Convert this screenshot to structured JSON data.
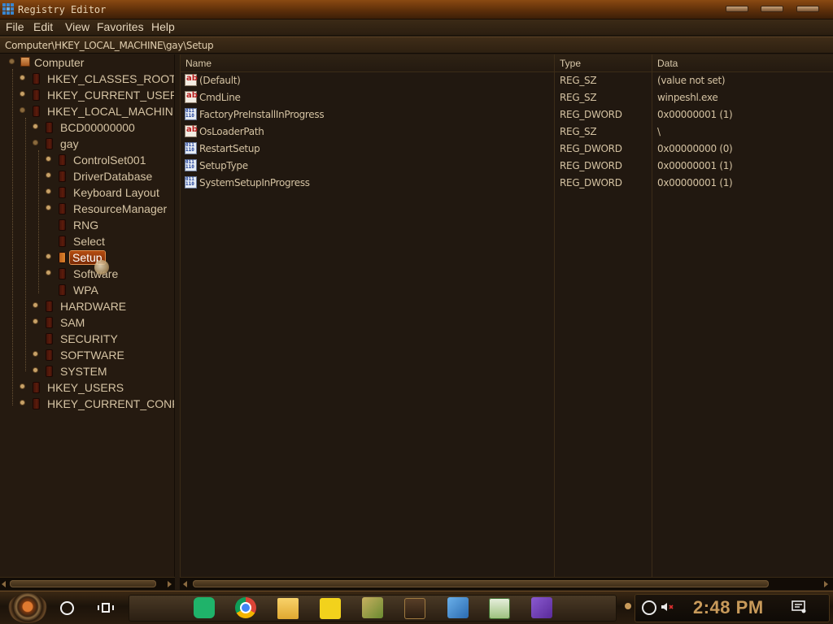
{
  "window": {
    "title": "Registry Editor"
  },
  "menu": {
    "file": "File",
    "edit": "Edit",
    "view": "View",
    "favorites": "Favorites",
    "help": "Help"
  },
  "address": {
    "path": "Computer\\HKEY_LOCAL_MACHINE\\gay\\Setup"
  },
  "tree": {
    "computer": "Computer",
    "hkcr": "HKEY_CLASSES_ROOT",
    "hkcu": "HKEY_CURRENT_USER",
    "hklm": "HKEY_LOCAL_MACHINE",
    "bcd": "BCD00000000",
    "gay": "gay",
    "controlset": "ControlSet001",
    "driverdb": "DriverDatabase",
    "keyboard": "Keyboard Layout",
    "resmgr": "ResourceManager",
    "rng": "RNG",
    "select": "Select",
    "setup": "Setup",
    "software_sub": "Software",
    "wpa": "WPA",
    "hardware": "HARDWARE",
    "sam": "SAM",
    "security": "SECURITY",
    "software": "SOFTWARE",
    "system": "SYSTEM",
    "hku": "HKEY_USERS",
    "hkcc": "HKEY_CURRENT_CONFIG"
  },
  "columns": {
    "name": "Name",
    "type": "Type",
    "data": "Data"
  },
  "values": [
    {
      "name": "(Default)",
      "type": "REG_SZ",
      "data": "(value not set)",
      "icon": "string-value-icon"
    },
    {
      "name": "CmdLine",
      "type": "REG_SZ",
      "data": "winpeshl.exe",
      "icon": "string-value-icon"
    },
    {
      "name": "FactoryPreInstallInProgress",
      "type": "REG_DWORD",
      "data": "0x00000001 (1)",
      "icon": "binary-value-icon"
    },
    {
      "name": "OsLoaderPath",
      "type": "REG_SZ",
      "data": "\\",
      "icon": "string-value-icon"
    },
    {
      "name": "RestartSetup",
      "type": "REG_DWORD",
      "data": "0x00000000 (0)",
      "icon": "binary-value-icon"
    },
    {
      "name": "SetupType",
      "type": "REG_DWORD",
      "data": "0x00000001 (1)",
      "icon": "binary-value-icon"
    },
    {
      "name": "SystemSetupInProgress",
      "type": "REG_DWORD",
      "data": "0x00000001 (1)",
      "icon": "binary-value-icon"
    }
  ],
  "value_icon_glyphs": {
    "sz": "ab",
    "dw": "011 110"
  },
  "taskbar": {
    "clock": "2:48 PM"
  },
  "colors": {
    "title_bar": "#6a360c",
    "selection": "#b44c10",
    "clock": "#c89a5a",
    "background": "#211810"
  }
}
